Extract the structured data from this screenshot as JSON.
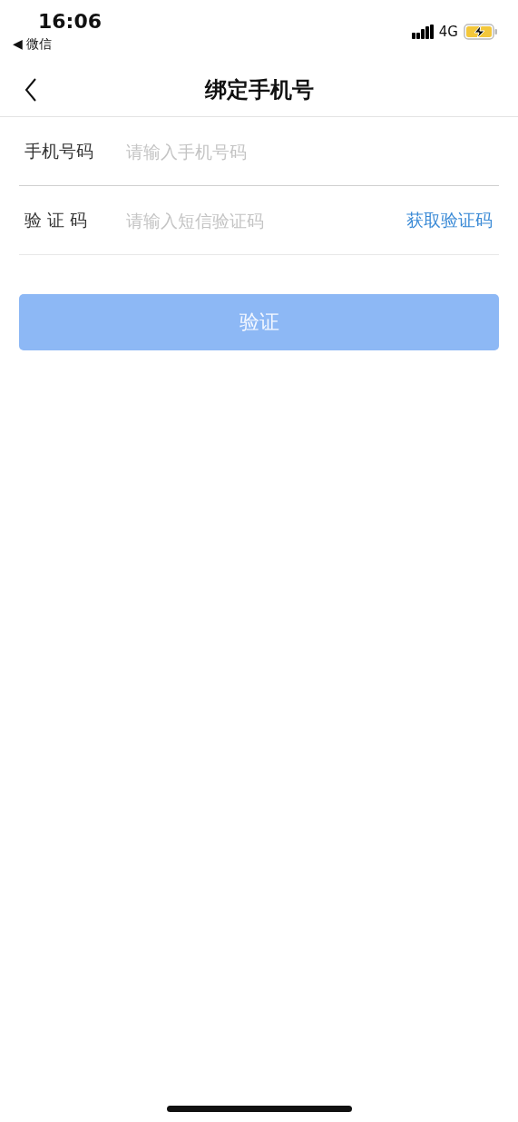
{
  "status_bar": {
    "time": "16:06",
    "back_app": "◀ 微信",
    "network": "4G"
  },
  "nav": {
    "title": "绑定手机号"
  },
  "fields": [
    {
      "label": "手机号码",
      "placeholder": "请输入手机号码"
    },
    {
      "label": "验 证 码",
      "placeholder": "请输入短信验证码",
      "action": "获取验证码"
    }
  ],
  "submit": {
    "label": "验证",
    "disabled": true
  }
}
